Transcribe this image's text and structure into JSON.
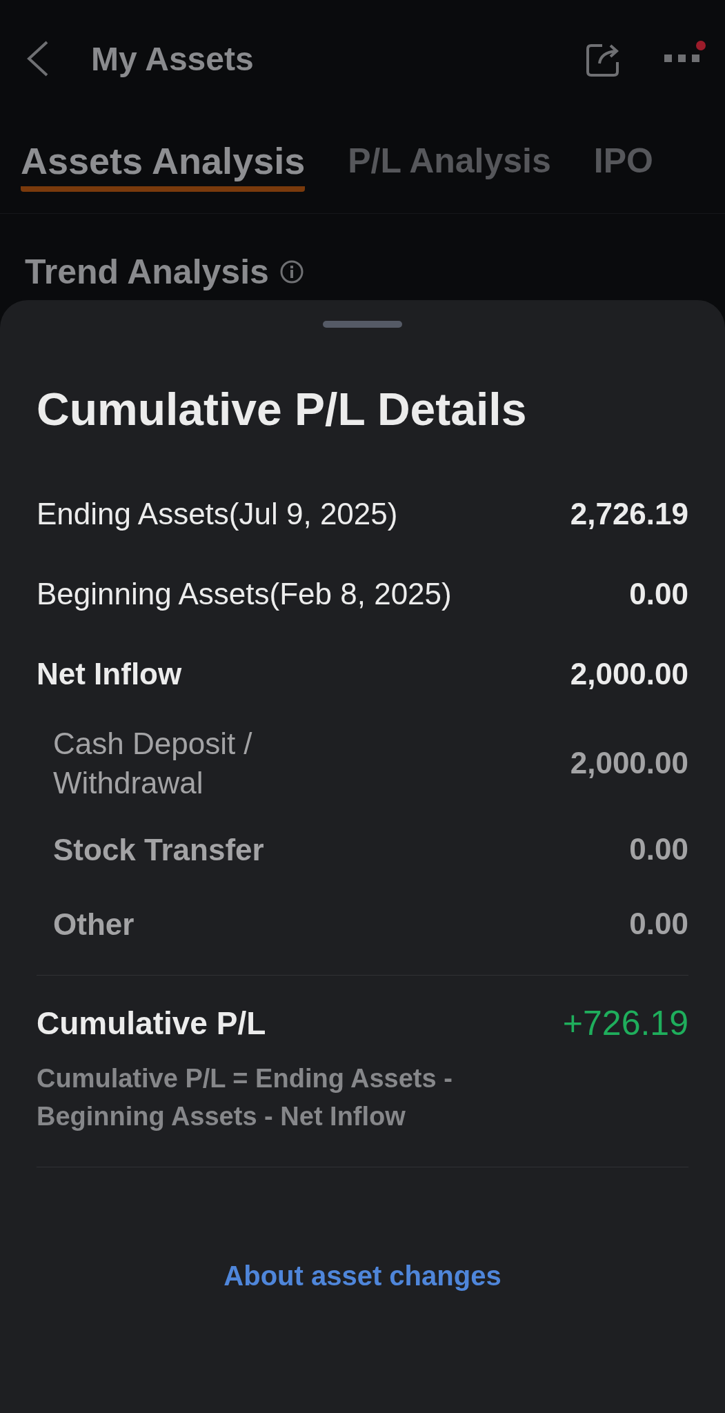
{
  "header": {
    "title": "My Assets",
    "more_badge": true
  },
  "tabs": [
    {
      "label": "Assets Analysis",
      "selected": true
    },
    {
      "label": "P/L Analysis",
      "selected": false
    },
    {
      "label": "IPO",
      "selected": false
    }
  ],
  "section_title": "Trend Analysis",
  "sheet": {
    "title": "Cumulative P/L Details",
    "rows": [
      {
        "kind": "normal",
        "label": "Ending Assets(Jul 9, 2025)",
        "value": "2,726.19"
      },
      {
        "kind": "normal",
        "label": "Beginning Assets(Feb 8, 2025)",
        "value": "0.00"
      },
      {
        "kind": "total",
        "label": "Net Inflow",
        "value": "2,000.00"
      },
      {
        "kind": "sub",
        "label": "Cash Deposit / Withdrawal",
        "value": "2,000.00"
      },
      {
        "kind": "sub_bold",
        "label": "Stock Transfer",
        "value": "0.00"
      },
      {
        "kind": "sub_bold",
        "label": "Other",
        "value": "0.00"
      }
    ],
    "result": {
      "label": "Cumulative P/L",
      "value": "+726.19"
    },
    "formula": "Cumulative P/L = Ending Assets - Beginning Assets - Net Inflow",
    "link": "About asset changes"
  }
}
